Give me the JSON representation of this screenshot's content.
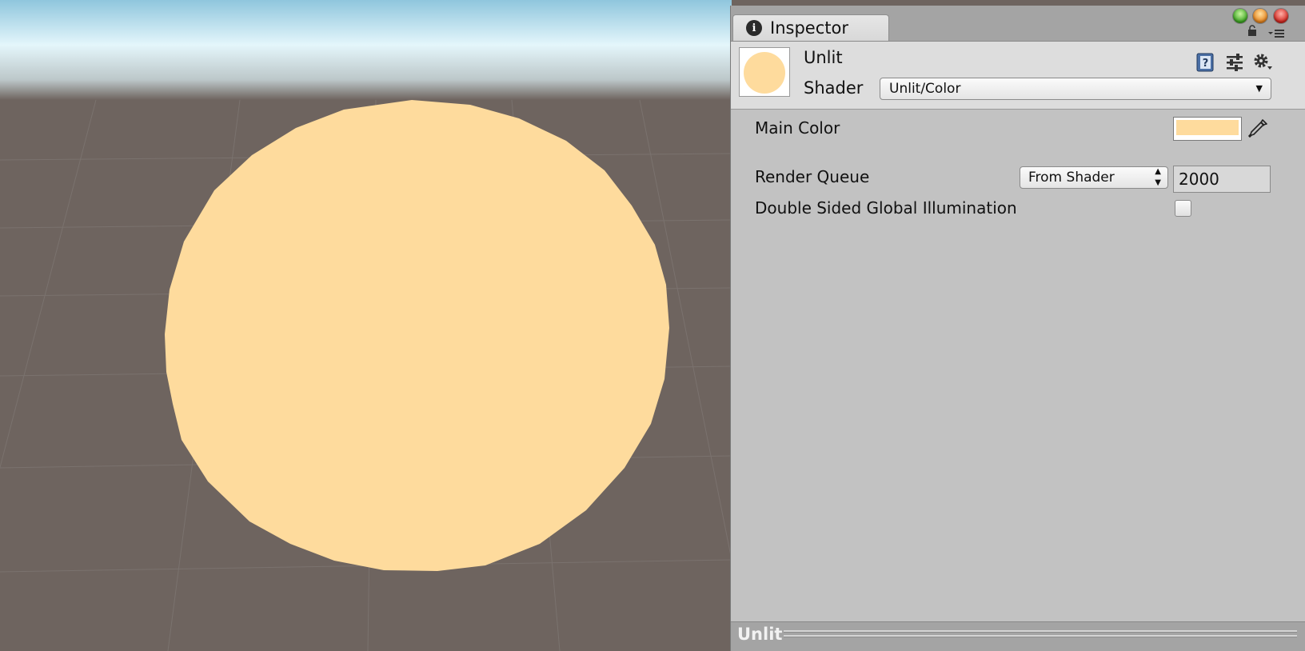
{
  "scene": {
    "sky_color": "#e4f6fb",
    "ground_color": "#6e645f",
    "sphere_color": "#fedb9d"
  },
  "inspector": {
    "tab_label": "Inspector",
    "tab_icon": "info-icon",
    "window_buttons": [
      "green",
      "orange",
      "red"
    ],
    "header_icons": [
      "help-book-icon",
      "presets-icon",
      "gear-icon"
    ],
    "material_name": "Unlit",
    "shader_label": "Shader",
    "shader_value": "Unlit/Color",
    "main_color_label": "Main Color",
    "main_color_value": "#fedb9d",
    "render_queue_label": "Render Queue",
    "render_queue_mode": "From Shader",
    "render_queue_value": "2000",
    "double_sided_gi_label": "Double Sided Global Illumination",
    "double_sided_gi_checked": false,
    "footer_label": "Unlit"
  }
}
